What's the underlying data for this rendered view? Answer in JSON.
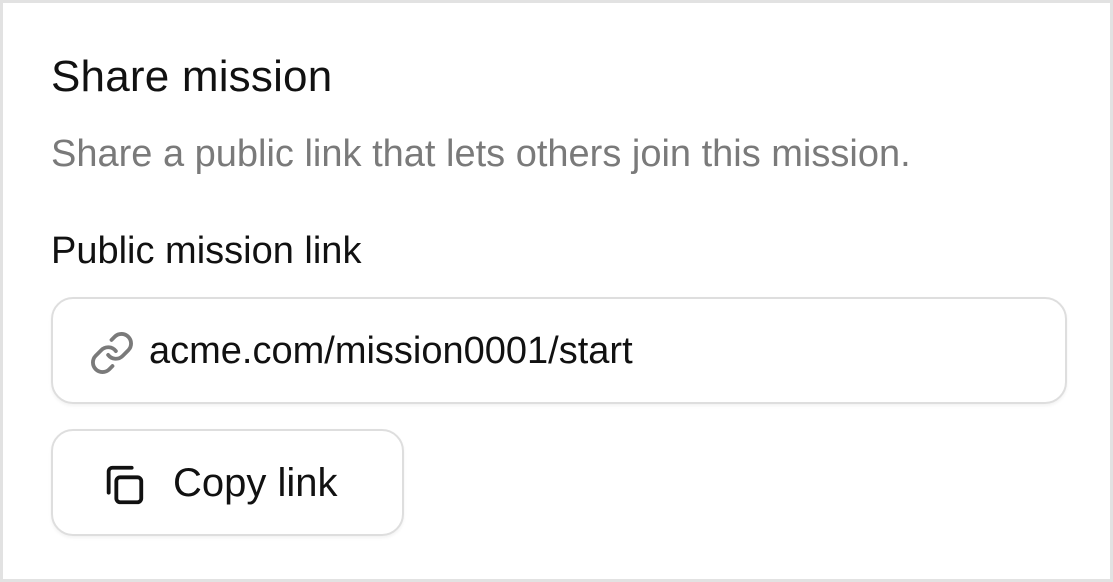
{
  "dialog": {
    "title": "Share mission",
    "description": "Share a public link that lets others join this mission."
  },
  "link_field": {
    "label": "Public mission link",
    "value": "acme.com/mission0001/start",
    "icon": "link-icon"
  },
  "copy_button": {
    "label": "Copy link",
    "icon": "copy-icon"
  },
  "colors": {
    "text_primary": "#111111",
    "text_secondary": "#7a7a7a",
    "icon_muted": "#7a7a7a",
    "border": "#dedede"
  }
}
